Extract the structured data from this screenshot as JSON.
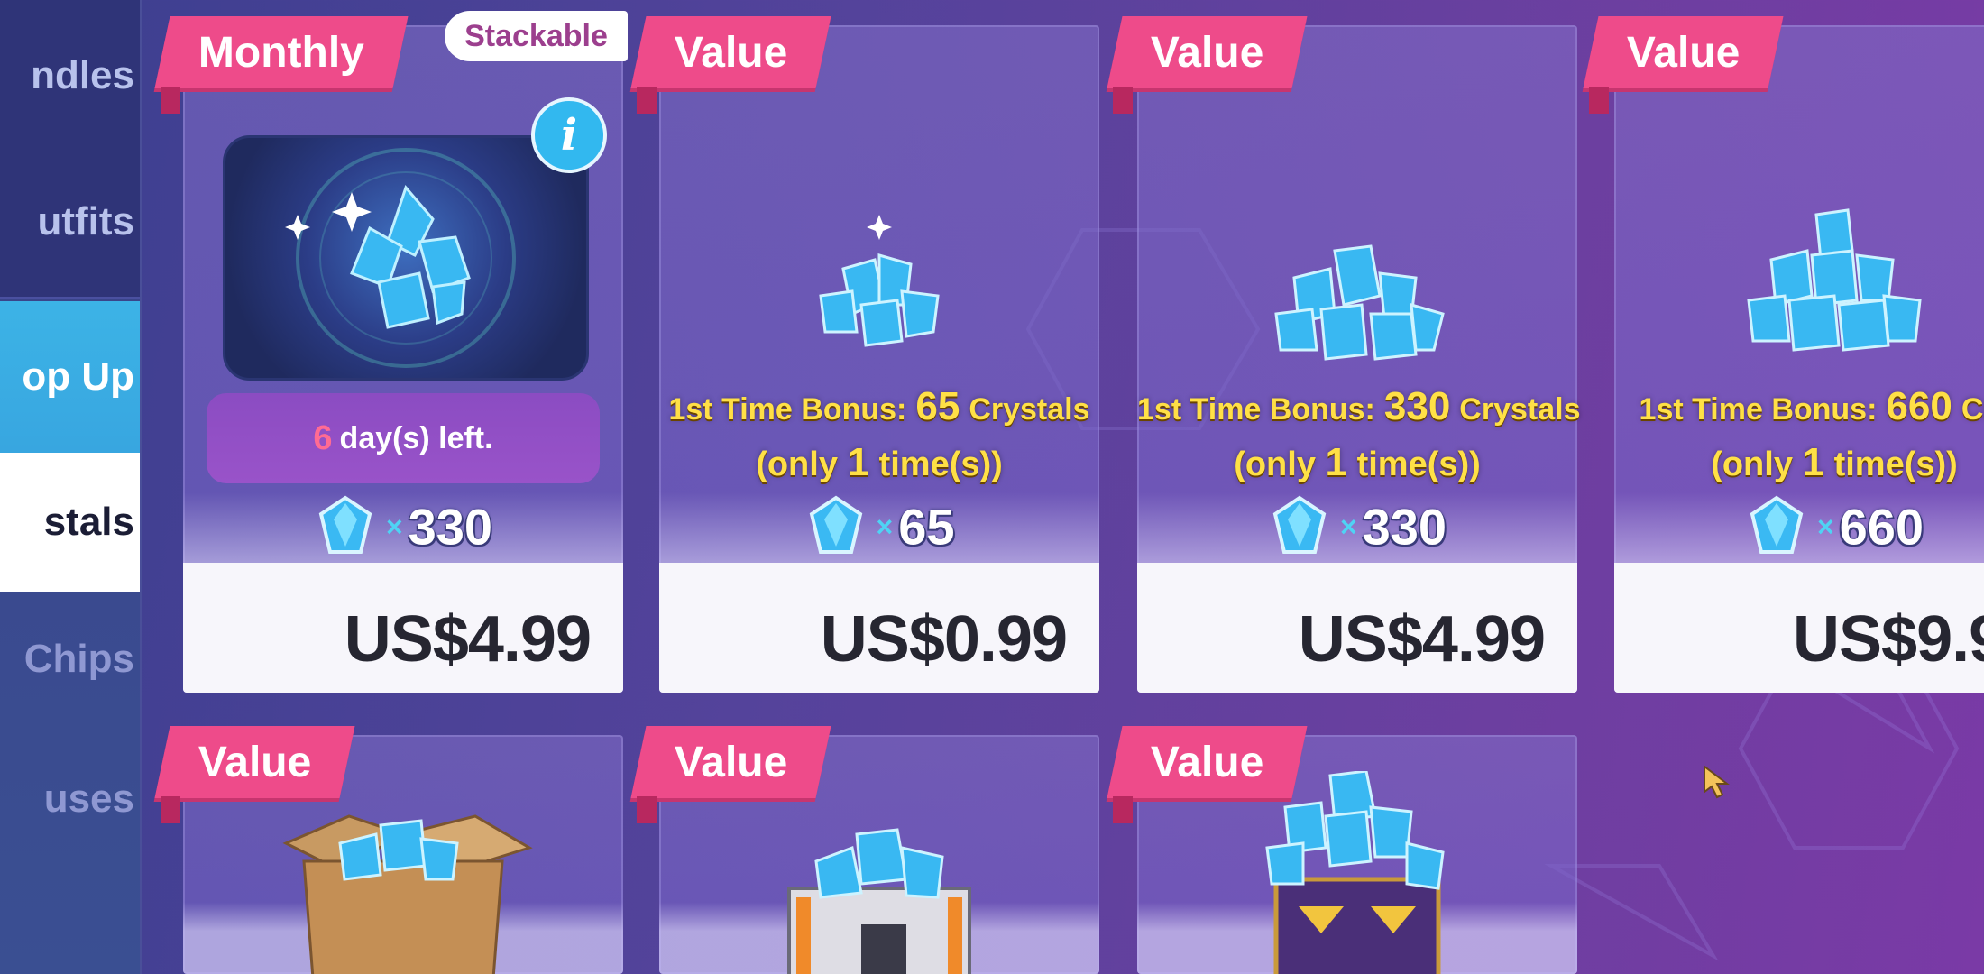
{
  "sidebar": {
    "items": [
      {
        "label": "ndles"
      },
      {
        "label": "utfits"
      },
      {
        "label": "op Up"
      },
      {
        "label": "stals"
      },
      {
        "label": "Chips"
      },
      {
        "label": "uses"
      }
    ]
  },
  "stackable_label": "Stackable",
  "cards": [
    {
      "tag": "Monthly",
      "days_num": "6",
      "days_text": "day(s) left.",
      "qty": "330",
      "price": "US$4.99"
    },
    {
      "tag": "Value",
      "bonus_prefix": "1st Time Bonus:",
      "bonus_num": "65",
      "bonus_unit": "Crystals",
      "limit_prefix": "(only",
      "limit_num": "1",
      "limit_suffix": "time(s))",
      "qty": "65",
      "price": "US$0.99"
    },
    {
      "tag": "Value",
      "bonus_prefix": "1st Time Bonus:",
      "bonus_num": "330",
      "bonus_unit": "Crystals",
      "limit_prefix": "(only",
      "limit_num": "1",
      "limit_suffix": "time(s))",
      "qty": "330",
      "price": "US$4.99"
    },
    {
      "tag": "Value",
      "bonus_prefix": "1st Time Bonus:",
      "bonus_num": "660",
      "bonus_unit": "Crys",
      "limit_prefix": "(only",
      "limit_num": "1",
      "limit_suffix": "time(s))",
      "qty": "660",
      "price": "US$9.9"
    },
    {
      "tag": "Value"
    },
    {
      "tag": "Value"
    },
    {
      "tag": "Value"
    }
  ],
  "qty_multiplier": "×",
  "info_symbol": "i",
  "colors": {
    "tag_pink": "#ee4b8a",
    "bonus_yellow": "#ffe046",
    "crystal_blue": "#4fd3f4",
    "active_tab": "#38a6e0"
  }
}
